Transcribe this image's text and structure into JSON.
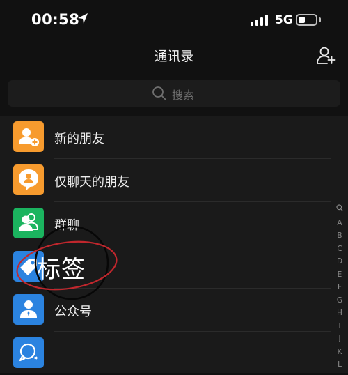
{
  "status": {
    "time": "00:58",
    "network": "5G",
    "battery_level": 0.4
  },
  "header": {
    "title": "通讯录"
  },
  "search": {
    "placeholder": "搜索"
  },
  "contacts_menu": [
    {
      "label": "新的朋友",
      "icon": "add-friend-icon",
      "color": "#F79B2E"
    },
    {
      "label": "仅聊天的朋友",
      "icon": "chat-only-friend-icon",
      "color": "#F79B2E"
    },
    {
      "label": "群聊",
      "icon": "group-chat-icon",
      "color": "#1BB45F"
    },
    {
      "label": "",
      "icon": "tag-icon",
      "color": "#2B83E0"
    },
    {
      "label": "公众号",
      "icon": "official-account-icon",
      "color": "#2B83E0"
    },
    {
      "label": "",
      "icon": "service-account-icon",
      "color": "#2B83E0"
    }
  ],
  "index_letters": [
    "Q",
    "A",
    "B",
    "C",
    "D",
    "E",
    "F",
    "G",
    "H",
    "I",
    "J",
    "K",
    "L"
  ],
  "overlay": {
    "zoom_text": "标签",
    "ellipse_color": "#C1272D"
  }
}
